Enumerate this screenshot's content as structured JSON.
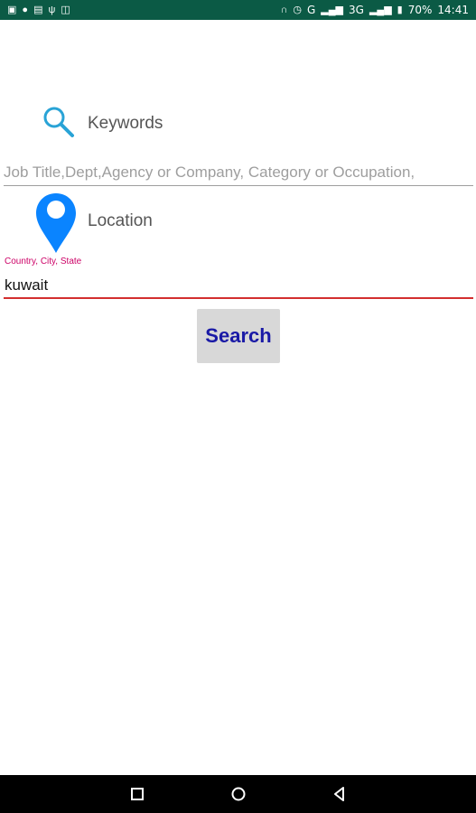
{
  "status_bar": {
    "battery_percent": "70%",
    "time": "14:41",
    "network": "3G",
    "carrier_letter": "G",
    "background_color": "#0b5a45"
  },
  "keywords": {
    "label": "Keywords",
    "placeholder": "Job Title,Dept,Agency or Company, Category or Occupation,",
    "icon": "search-icon"
  },
  "location": {
    "label": "Location",
    "hint": "Country, City, State",
    "value": "kuwait",
    "icon": "map-pin-icon"
  },
  "search_button": {
    "label": "Search"
  },
  "colors": {
    "search_icon": "#29a3d6",
    "pin": "#0a84ff",
    "hint": "#cc0066",
    "active_underline": "#d32f2f",
    "button_text": "#1a1aa6"
  }
}
